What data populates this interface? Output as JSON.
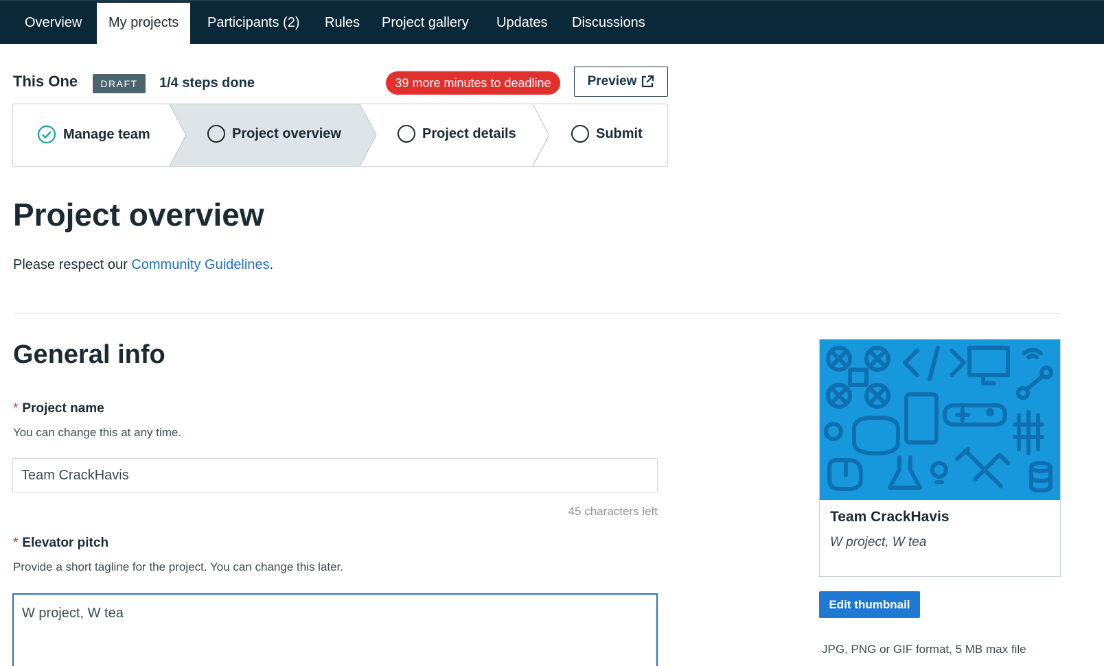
{
  "nav": {
    "tabs": [
      {
        "label": "Overview",
        "active": false
      },
      {
        "label": "My projects",
        "active": true
      },
      {
        "label": "Participants (2)",
        "active": false
      },
      {
        "label": "Rules",
        "active": false
      },
      {
        "label": "Project gallery",
        "active": false
      },
      {
        "label": "Updates",
        "active": false
      },
      {
        "label": "Discussions",
        "active": false
      }
    ]
  },
  "header": {
    "project_title": "This One",
    "status_badge": "DRAFT",
    "steps_done": "1/4 steps done",
    "deadline": "39 more minutes to deadline",
    "preview_label": "Preview"
  },
  "stepper": {
    "steps": [
      {
        "label": "Manage team",
        "state": "done"
      },
      {
        "label": "Project overview",
        "state": "current"
      },
      {
        "label": "Project details",
        "state": "todo"
      },
      {
        "label": "Submit",
        "state": "todo"
      }
    ]
  },
  "page": {
    "title": "Project overview",
    "guidelines_prefix": "Please respect our ",
    "guidelines_link": "Community Guidelines",
    "guidelines_suffix": "."
  },
  "general_info": {
    "title": "General info",
    "project_name": {
      "required_mark": "*",
      "label": "Project name",
      "help": "You can change this at any time.",
      "value": "Team CrackHavis",
      "chars_left": "45 characters left"
    },
    "elevator_pitch": {
      "required_mark": "*",
      "label": "Elevator pitch",
      "help": "Provide a short tagline for the project. You can change this later.",
      "value": "W project, W tea"
    }
  },
  "thumbnail": {
    "name": "Team CrackHavis",
    "pitch": "W project, W tea",
    "edit_label": "Edit thumbnail",
    "format_note": "JPG, PNG or GIF format, 5 MB max file"
  },
  "colors": {
    "nav_bg": "#0b2838",
    "deadline_bg": "#e0312f",
    "link": "#1f6fc1",
    "primary_button": "#1f78d1",
    "thumbnail_bg": "#1798dc",
    "check": "#1aa39a"
  }
}
